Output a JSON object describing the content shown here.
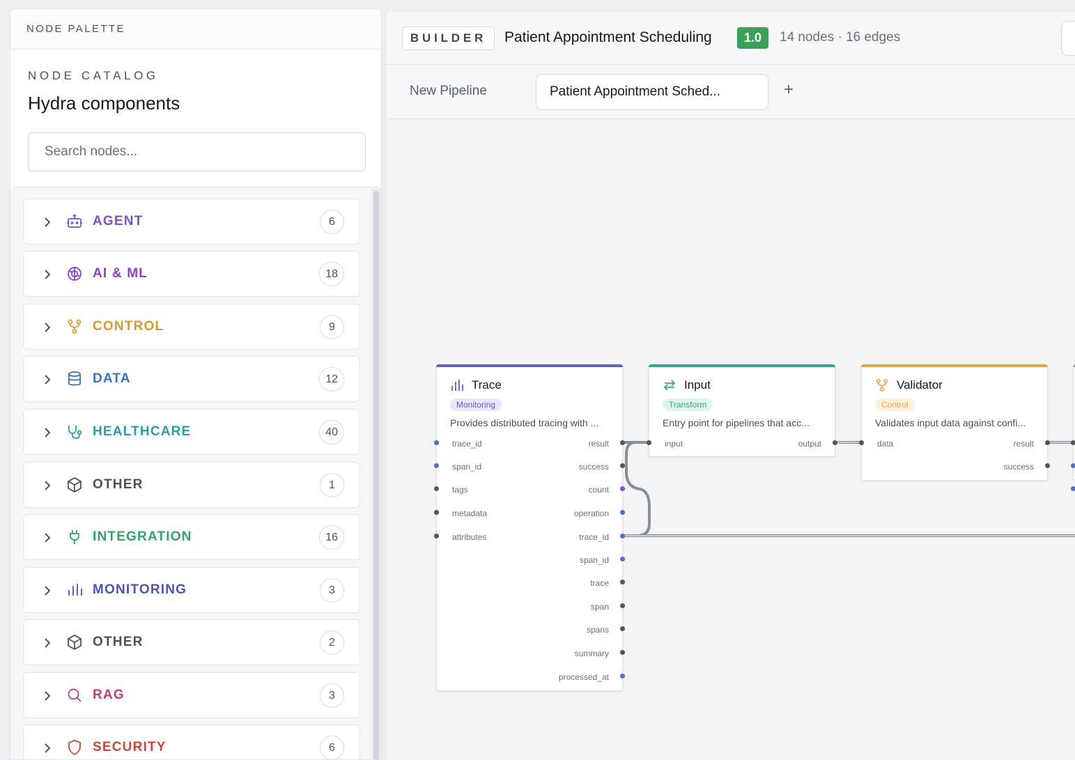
{
  "palette": {
    "header": "NODE PALETTE",
    "catalog_kicker": "NODE CATALOG",
    "catalog_title": "Hydra components",
    "search_placeholder": "Search nodes...",
    "categories": [
      {
        "label": "AGENT",
        "count": "6",
        "icon": "robot-icon",
        "color": "#7a4fd0"
      },
      {
        "label": "AI & ML",
        "count": "18",
        "icon": "brain-icon",
        "color": "#8a3fc9"
      },
      {
        "label": "CONTROL",
        "count": "9",
        "icon": "branch-icon",
        "color": "#d89a2e"
      },
      {
        "label": "DATA",
        "count": "12",
        "icon": "database-icon",
        "color": "#3d6fc4"
      },
      {
        "label": "HEALTHCARE",
        "count": "40",
        "icon": "stethoscope-icon",
        "color": "#2b9bb0"
      },
      {
        "label": "OTHER",
        "count": "1",
        "icon": "cube-icon",
        "color": "#4b5159"
      },
      {
        "label": "INTEGRATION",
        "count": "16",
        "icon": "plug-icon",
        "color": "#2ea46b"
      },
      {
        "label": "MONITORING",
        "count": "3",
        "icon": "bar-chart-icon",
        "color": "#4b54b8"
      },
      {
        "label": "OTHER",
        "count": "2",
        "icon": "cube-icon",
        "color": "#4b5159"
      },
      {
        "label": "RAG",
        "count": "3",
        "icon": "search-icon",
        "color": "#c23c78"
      },
      {
        "label": "SECURITY",
        "count": "6",
        "icon": "shield-icon",
        "color": "#d0433b"
      }
    ]
  },
  "builder": {
    "chip": "BUILDER",
    "title": "Patient Appointment Scheduling",
    "version": "1.0",
    "stats": "14 nodes · 16 edges"
  },
  "tabs": {
    "plain": "New Pipeline",
    "active": "Patient Appointment Sched...",
    "add": "+"
  },
  "nodes": {
    "trace": {
      "title": "Trace",
      "badge": "Monitoring",
      "description": "Provides distributed tracing with ...",
      "color": "#5b5fc7",
      "inputs": [
        "trace_id",
        "span_id",
        "tags",
        "metadata",
        "attributes"
      ],
      "outputs": [
        "result",
        "success",
        "count",
        "operation",
        "trace_id",
        "span_id",
        "trace",
        "span",
        "spans",
        "summary",
        "processed_at"
      ]
    },
    "input": {
      "title": "Input",
      "badge": "Transform",
      "description": "Entry point for pipelines that acc...",
      "color": "#3aa58e",
      "inputs": [
        "input"
      ],
      "outputs": [
        "output"
      ]
    },
    "validator": {
      "title": "Validator",
      "badge": "Control",
      "description": "Validates input data against confi...",
      "color": "#e0a64a",
      "inputs": [
        "data"
      ],
      "outputs": [
        "result",
        "success"
      ]
    }
  }
}
